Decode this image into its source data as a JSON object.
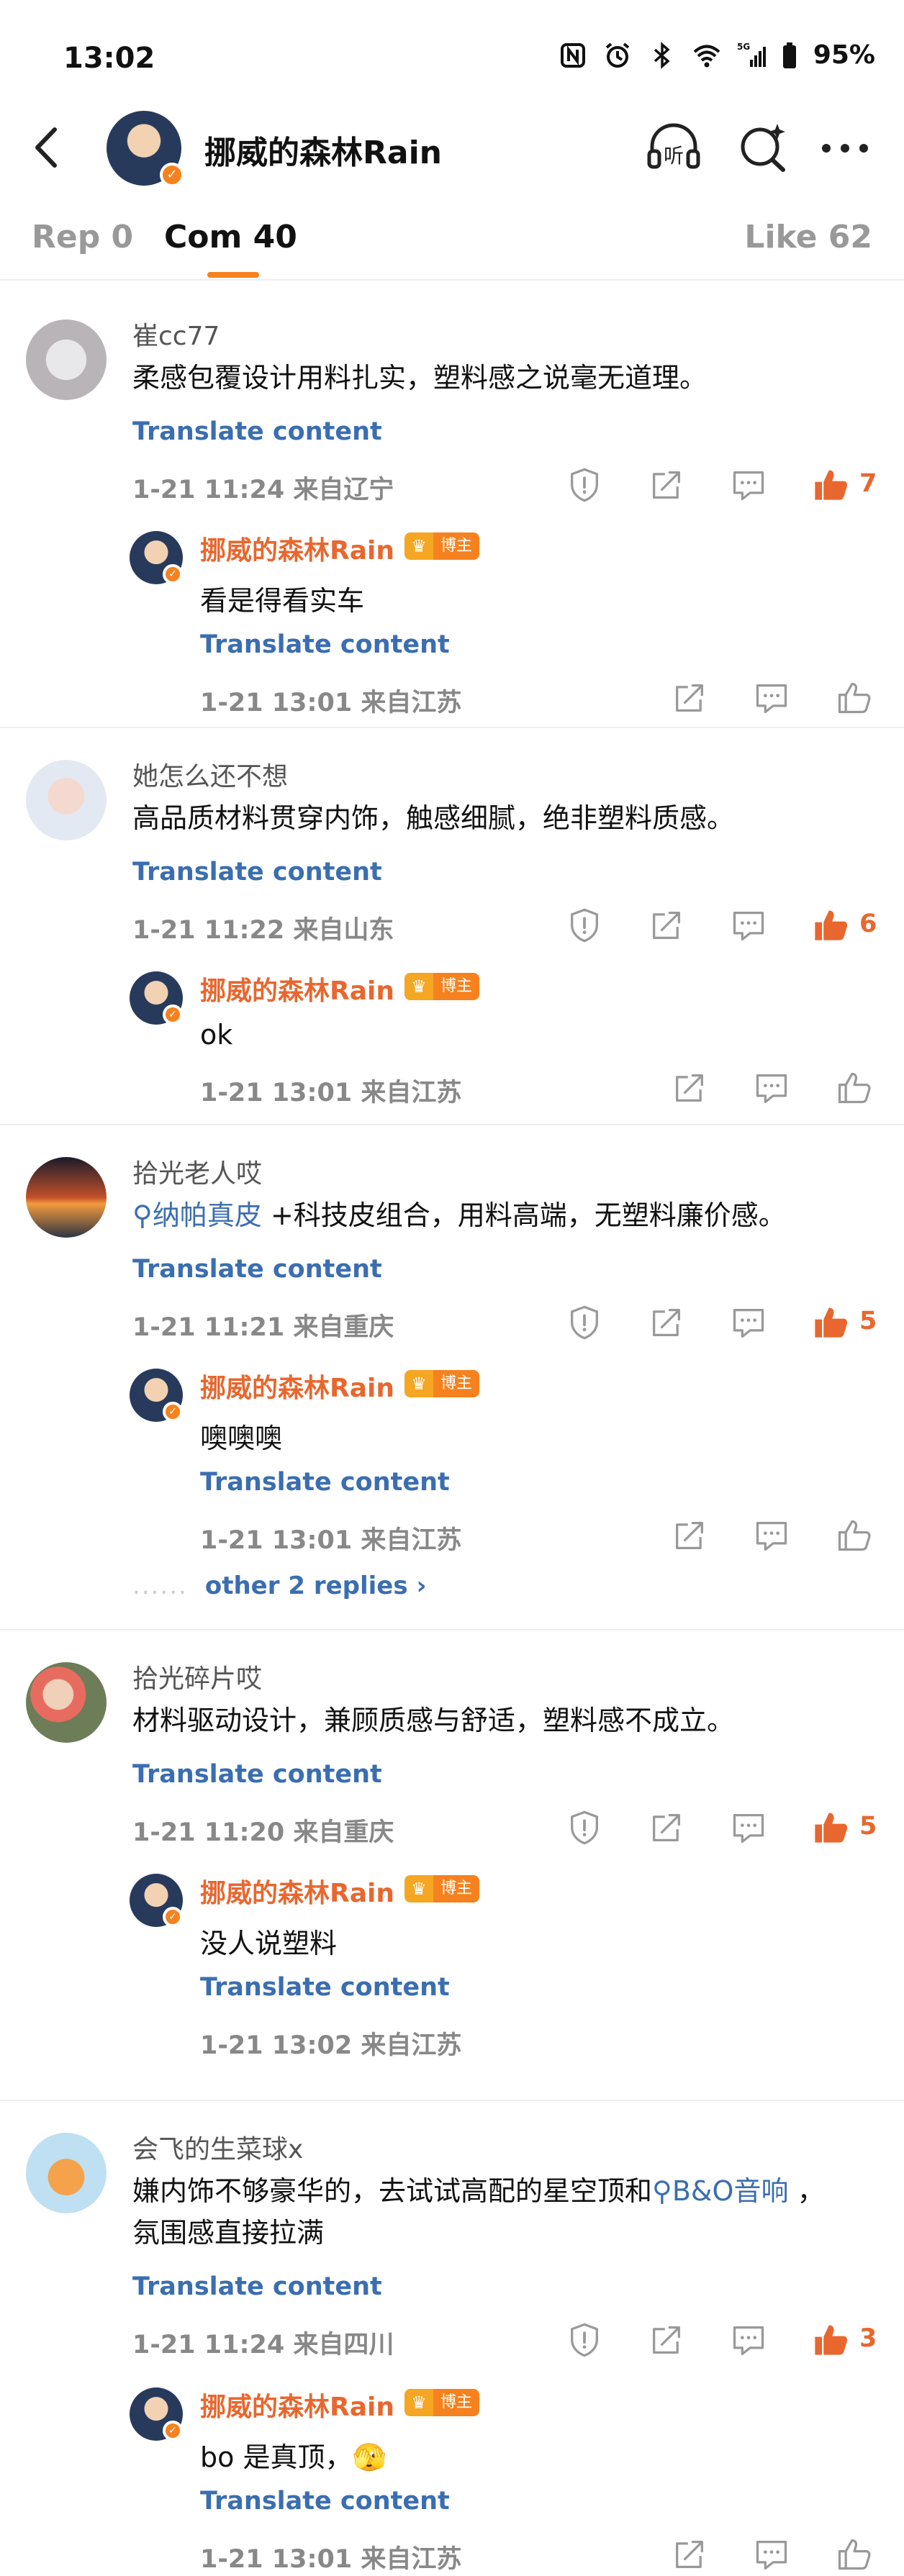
{
  "status": {
    "time": "13:02",
    "battery": "95%",
    "network": "5G"
  },
  "header": {
    "title": "挪威的森林Rain",
    "back_icon": "back-arrow-icon",
    "listen_icon": "headphones-listen-icon",
    "search_icon": "ai-search-icon",
    "more_icon": "more-dots-icon"
  },
  "tabs": [
    {
      "label": "Rep 0"
    },
    {
      "label": "Com 40"
    },
    {
      "label": "Like 62"
    }
  ],
  "accent": "#f5821f",
  "link_color": "#3b6eb0",
  "comments": [
    {
      "user": "崔cc77",
      "text": "柔感包覆设计用料扎实，塑料感之说毫无道理。",
      "translate": "Translate content",
      "meta": "1-21 11:24 来自辽宁",
      "likes": "7",
      "reply": {
        "user": "挪威的森林Rain",
        "badge": "博主",
        "text": "看是得看实车",
        "translate": "Translate content",
        "meta": "1-21 13:01 来自江苏"
      }
    },
    {
      "user": "她怎么还不想",
      "text": "高品质材料贯穿内饰，触感细腻，绝非塑料质感。",
      "translate": "Translate content",
      "meta": "1-21 11:22 来自山东",
      "likes": "6",
      "reply": {
        "user": "挪威的森林Rain",
        "badge": "博主",
        "text": "ok",
        "meta": "1-21 13:01 来自江苏"
      }
    },
    {
      "user": "拾光老人哎",
      "topic": "纳帕真皮",
      "text_after": " +科技皮组合，用料高端，无塑料廉价感。",
      "translate": "Translate content",
      "meta": "1-21 11:21 来自重庆",
      "likes": "5",
      "reply": {
        "user": "挪威的森林Rain",
        "badge": "博主",
        "text": "噢噢噢",
        "translate": "Translate content",
        "meta": "1-21 13:01 来自江苏"
      },
      "more": "other 2 replies"
    },
    {
      "user": "拾光碎片哎",
      "text": "材料驱动设计，兼顾质感与舒适，塑料感不成立。",
      "translate": "Translate content",
      "meta": "1-21 11:20 来自重庆",
      "likes": "5",
      "reply": {
        "user": "挪威的森林Rain",
        "badge": "博主",
        "text": "没人说塑料",
        "translate": "Translate content",
        "meta": "1-21 13:02 来自江苏"
      }
    },
    {
      "user": "会飞的生菜球x",
      "text_before": "嫌内饰不够豪华的，去试试高配的星空顶和",
      "topic": "B&O音响",
      "text_after": " ，",
      "text_line2": "氛围感直接拉满",
      "translate": "Translate content",
      "meta": "1-21 11:24 来自四川",
      "likes": "3",
      "reply": {
        "user": "挪威的森林Rain",
        "badge": "博主",
        "text": "bo 是真顶，🫣",
        "translate": "Translate content",
        "meta": "1-21 13:01 来自江苏"
      }
    }
  ]
}
